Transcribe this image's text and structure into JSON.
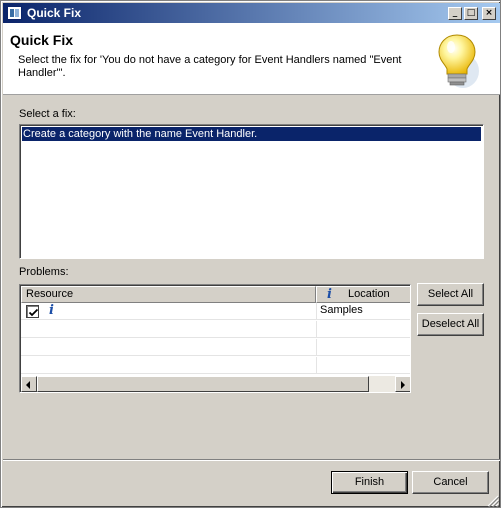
{
  "window": {
    "title": "Quick Fix",
    "controls": {
      "minimize": "_",
      "maximize": "□",
      "close": "×"
    }
  },
  "header": {
    "title": "Quick Fix",
    "message": "Select the fix for 'You do not have a category for Event Handlers named \"Event Handler\"'.",
    "icon": "lightbulb-icon"
  },
  "fixes": {
    "label": "Select a fix:",
    "items": [
      "Create a category with the name Event Handler."
    ]
  },
  "problems": {
    "label": "Problems:",
    "columns": {
      "resource": "Resource",
      "location": "Location"
    },
    "rows": [
      {
        "checked": true,
        "icon": "info-icon",
        "resource": "",
        "location": "Samples"
      }
    ]
  },
  "buttons": {
    "select_all": "Select All",
    "deselect_all": "Deselect All",
    "finish": "Finish",
    "cancel": "Cancel"
  },
  "colors": {
    "selection": "#0a246a",
    "dialog_bg": "#d4d0c8",
    "info_icon": "#1c4ea7"
  }
}
